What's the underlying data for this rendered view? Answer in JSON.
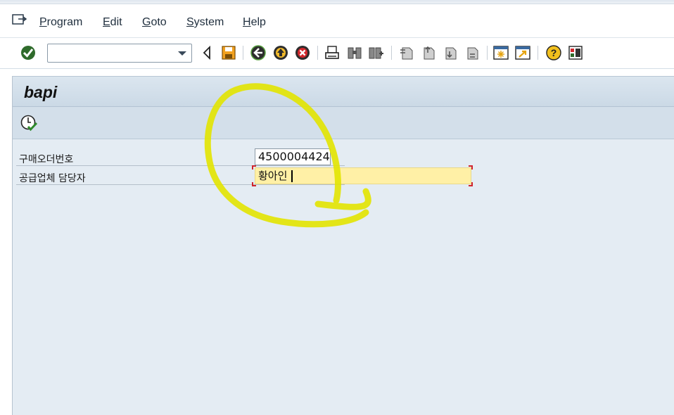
{
  "menu": {
    "items": [
      {
        "label": "Program"
      },
      {
        "label": "Edit"
      },
      {
        "label": "Goto"
      },
      {
        "label": "System"
      },
      {
        "label": "Help"
      }
    ]
  },
  "toolbar": {
    "command_field": {
      "value": "",
      "placeholder": ""
    },
    "icons": [
      "enter-icon",
      "back-arrow-icon",
      "save-icon",
      "back-icon",
      "exit-icon",
      "cancel-icon",
      "print-icon",
      "find-icon",
      "find-next-icon",
      "first-page-icon",
      "previous-page-icon",
      "next-page-icon",
      "last-page-icon",
      "new-session-icon",
      "shortcut-icon",
      "help-icon",
      "layout-menu-icon"
    ]
  },
  "screen": {
    "title": "bapi"
  },
  "form": {
    "fields": [
      {
        "label": "구매오더번호",
        "value": "4500004424"
      },
      {
        "label": "공급업체 담당자",
        "value": "황아인"
      }
    ]
  },
  "colors": {
    "annotation": "#e4e400",
    "input_focus_bg": "#fff0a6",
    "content_bg": "#e4ecf3"
  }
}
